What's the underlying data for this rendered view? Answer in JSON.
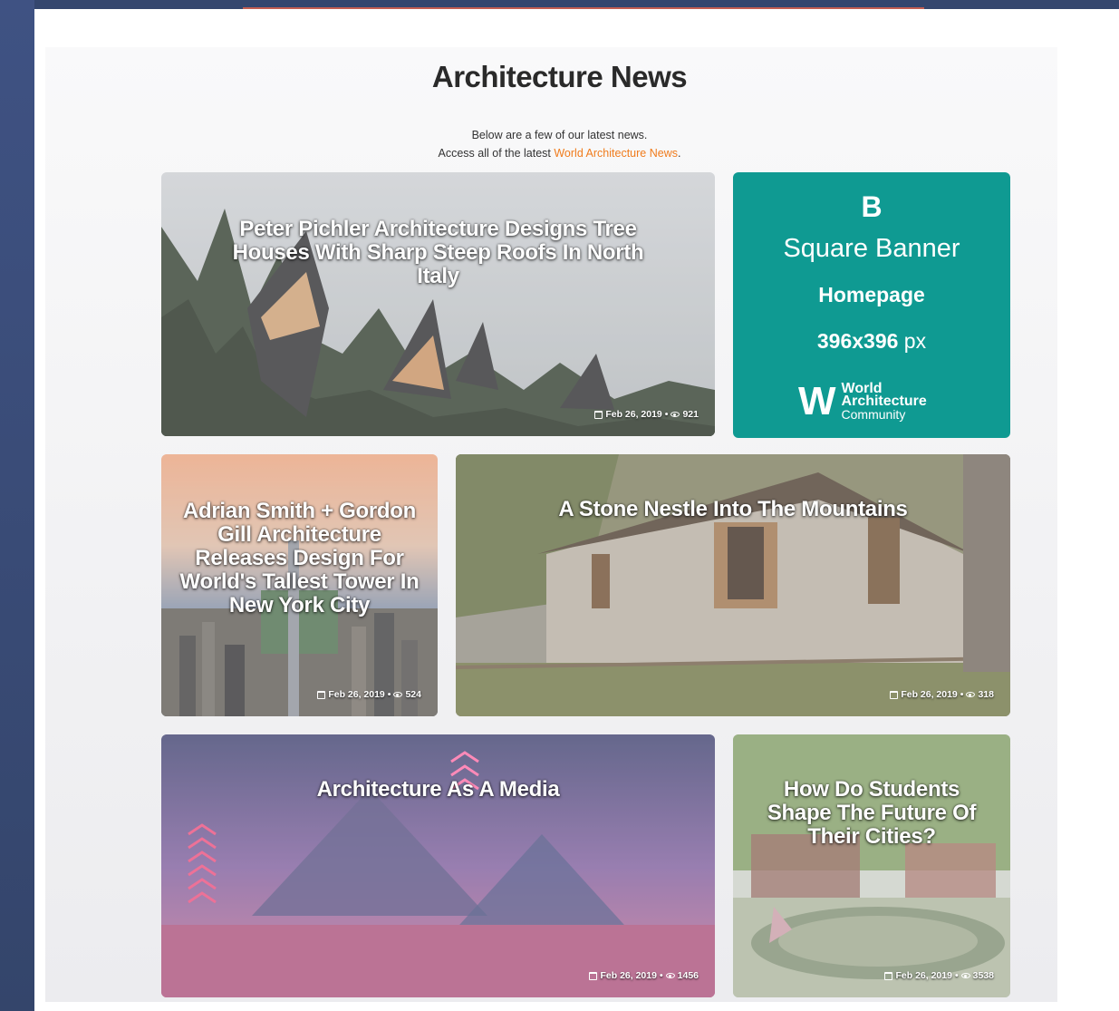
{
  "header": {
    "title": "Architecture News",
    "intro_line1": "Below are a few of our latest news.",
    "intro_line2_prefix": "Access all of the latest ",
    "intro_link": "World Architecture News",
    "intro_line2_suffix": "."
  },
  "articles": [
    {
      "title": "Peter Pichler Architecture Designs Tree Houses With Sharp Steep Roofs In North Italy",
      "date": "Feb 26, 2019",
      "views": "921"
    },
    {
      "title": "Adrian Smith + Gordon Gill Architecture Releases Design For World's Tallest Tower In New York City",
      "date": "Feb 26, 2019",
      "views": "524"
    },
    {
      "title": "A Stone Nestle Into The Mountains",
      "date": "Feb 26, 2019",
      "views": "318"
    },
    {
      "title": "Architecture As A Media",
      "date": "Feb 26, 2019",
      "views": "1456"
    },
    {
      "title": "How Do Students Shape The Future Of Their Cities?",
      "date": "Feb 26, 2019",
      "views": "3538"
    }
  ],
  "banner": {
    "logo": "B",
    "title": "Square Banner",
    "page": "Homepage",
    "size_value": "396x396",
    "size_unit": " px",
    "brand_mark": "W",
    "brand_line1": "World",
    "brand_line2": "Architecture",
    "brand_line3": "Community",
    "color": "#0f9a92"
  },
  "meta_separator": "•",
  "icons": {
    "date": "calendar-icon",
    "views": "eye-icon"
  },
  "colors": {
    "link": "#f07c1d",
    "background": "#34466e"
  }
}
